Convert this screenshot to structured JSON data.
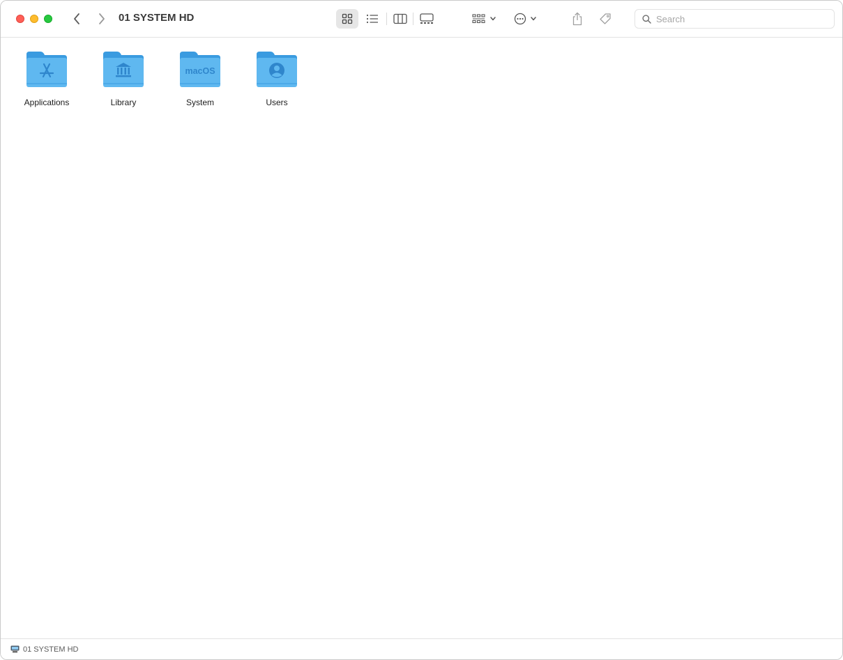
{
  "window": {
    "title": "01 SYSTEM HD"
  },
  "toolbar": {
    "back_icon": "chevron-left-icon",
    "forward_icon": "chevron-right-icon",
    "view_modes": [
      {
        "name": "icon-view",
        "icon": "grid-icon",
        "selected": true
      },
      {
        "name": "list-view",
        "icon": "list-icon",
        "selected": false
      },
      {
        "name": "column-view",
        "icon": "columns-icon",
        "selected": false
      },
      {
        "name": "gallery-view",
        "icon": "gallery-icon",
        "selected": false
      }
    ],
    "group_icon": "group-grid-icon",
    "more_icon": "ellipsis-circle-icon",
    "share_icon": "share-icon",
    "tags_icon": "tag-icon"
  },
  "search": {
    "placeholder": "Search",
    "value": ""
  },
  "items": [
    {
      "label": "Applications",
      "icon": "app-store-folder-icon"
    },
    {
      "label": "Library",
      "icon": "library-folder-icon"
    },
    {
      "label": "System",
      "icon": "macos-folder-icon",
      "badge": "macOS"
    },
    {
      "label": "Users",
      "icon": "users-folder-icon"
    }
  ],
  "statusbar": {
    "path_label": "01 SYSTEM HD",
    "icon": "hard-disk-icon"
  },
  "colors": {
    "folder_body": "#5fb8f0",
    "folder_tab": "#3a9be0",
    "folder_glyph": "#2f86cc",
    "close": "#ff5f57",
    "minimize": "#febc2e",
    "maximize": "#28c840"
  }
}
